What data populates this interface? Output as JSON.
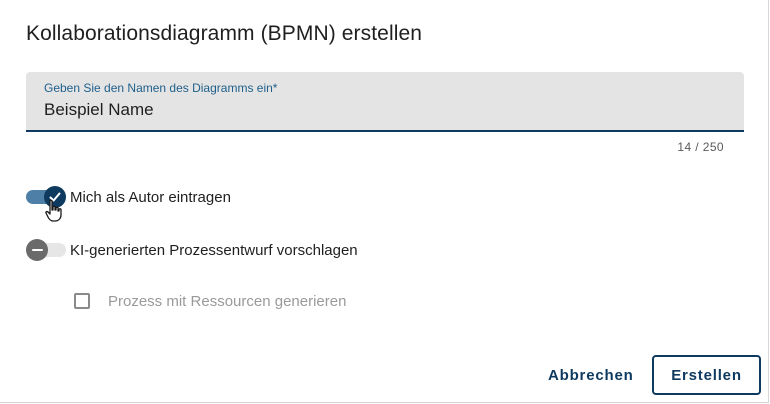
{
  "dialog": {
    "title": "Kollaborationsdiagramm (BPMN) erstellen",
    "name_field": {
      "label": "Geben Sie den Namen des Diagramms ein*",
      "value": "Beispiel Name",
      "counter": "14 / 250"
    },
    "toggles": [
      {
        "label": "Mich als Autor eintragen",
        "checked": true
      },
      {
        "label": "KI-generierten Prozessentwurf vorschlagen",
        "checked": false
      }
    ],
    "checkbox": {
      "label": "Prozess mit Ressourcen generieren",
      "checked": false,
      "disabled": true
    },
    "buttons": {
      "cancel": "Abbrechen",
      "create": "Erstellen"
    }
  },
  "colors": {
    "primary": "#0f3a5f",
    "field_bg": "#e4e4e4",
    "label_blue": "#1f5f8b",
    "disabled_text": "#9a9a9a"
  },
  "icons": {
    "toggle_on": "check-icon",
    "toggle_off": "minus-icon",
    "cursor": "hand-pointer-icon"
  }
}
